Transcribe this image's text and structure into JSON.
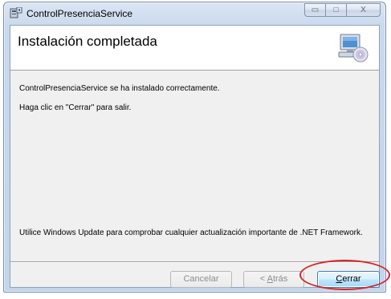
{
  "window": {
    "title": "ControlPresenciaService",
    "minimize_glyph": "▭",
    "maximize_glyph": "□",
    "close_glyph": "X"
  },
  "header": {
    "title": "Instalación completada",
    "icon": "computer-cd-icon"
  },
  "body": {
    "line1": "ControlPresenciaService se ha instalado correctamente.",
    "line2": "Haga clic en \"Cerrar\" para salir.",
    "note": "Utilice Windows Update para comprobar cualquier actualización importante de .NET Framework."
  },
  "buttons": {
    "cancel": "Cancelar",
    "back_prefix": "< ",
    "back_accel": "A",
    "back_rest": "trás",
    "close_accel": "C",
    "close_rest": "errar"
  },
  "colors": {
    "highlight_ring": "#d9242a",
    "primary_button_border": "#3c7fb1"
  }
}
